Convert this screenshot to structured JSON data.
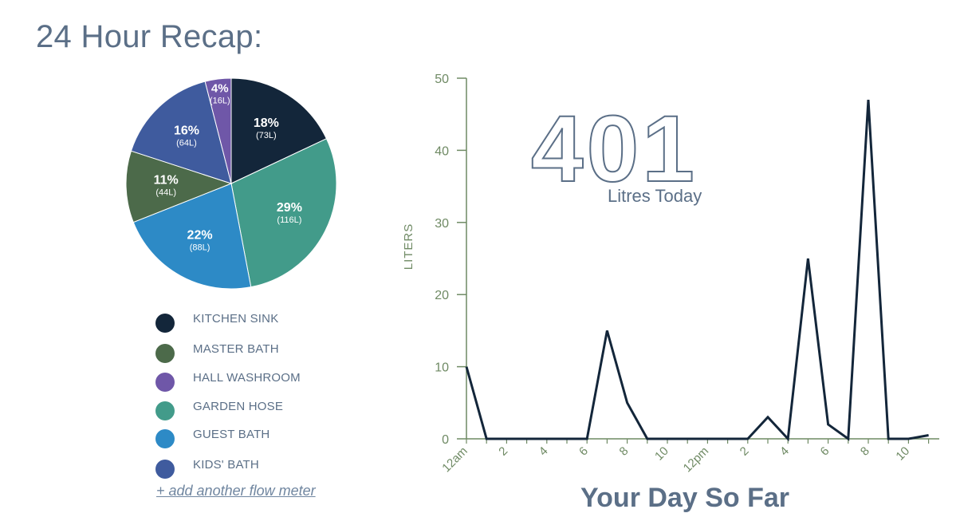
{
  "page": {
    "title": "24 Hour Recap:",
    "add_meter_link": "+ add another flow meter"
  },
  "summary": {
    "total": "401",
    "caption": "Litres Today"
  },
  "legend": [
    {
      "label": "KITCHEN SINK",
      "color": "#13263a"
    },
    {
      "label": "MASTER BATH",
      "color": "#4c6a4a"
    },
    {
      "label": "HALL WASHROOM",
      "color": "#6f57a8"
    },
    {
      "label": "GARDEN HOSE",
      "color": "#429b8a"
    },
    {
      "label": "GUEST BATH",
      "color": "#2d8ac6"
    },
    {
      "label": "KIDS' BATH",
      "color": "#3f5b9e"
    }
  ],
  "chart_data": [
    {
      "type": "pie",
      "slices": [
        {
          "name": "KITCHEN SINK",
          "percent": 18,
          "litres": 73,
          "pct_label": "18%",
          "litres_label": "(73L)",
          "color": "#13263a"
        },
        {
          "name": "GARDEN HOSE",
          "percent": 29,
          "litres": 116,
          "pct_label": "29%",
          "litres_label": "(116L)",
          "color": "#429b8a"
        },
        {
          "name": "GUEST BATH",
          "percent": 22,
          "litres": 88,
          "pct_label": "22%",
          "litres_label": "(88L)",
          "color": "#2d8ac6"
        },
        {
          "name": "MASTER BATH",
          "percent": 11,
          "litres": 44,
          "pct_label": "11%",
          "litres_label": "(44L)",
          "color": "#4c6a4a"
        },
        {
          "name": "KIDS' BATH",
          "percent": 16,
          "litres": 64,
          "pct_label": "16%",
          "litres_label": "(64L)",
          "color": "#3f5b9e"
        },
        {
          "name": "HALL WASHROOM",
          "percent": 4,
          "litres": 16,
          "pct_label": "4%",
          "litres_label": "(16L)",
          "color": "#6f57a8"
        }
      ]
    },
    {
      "type": "line",
      "title": "Your Day So Far",
      "ylabel": "LITERS",
      "ylim": [
        0,
        50
      ],
      "yticks": [
        0,
        10,
        20,
        30,
        40,
        50
      ],
      "x_labels": [
        "12am",
        "2",
        "4",
        "6",
        "8",
        "10",
        "12pm",
        "2",
        "4",
        "6",
        "8",
        "10"
      ],
      "values": [
        10,
        0,
        0,
        0,
        0,
        0,
        0,
        15,
        5,
        0,
        0,
        0,
        0,
        0,
        0,
        3,
        0,
        25,
        2,
        0,
        47,
        0,
        0,
        0.5
      ],
      "line_color": "#13263a",
      "axis_color": "#6f8a64",
      "grid": false
    }
  ]
}
